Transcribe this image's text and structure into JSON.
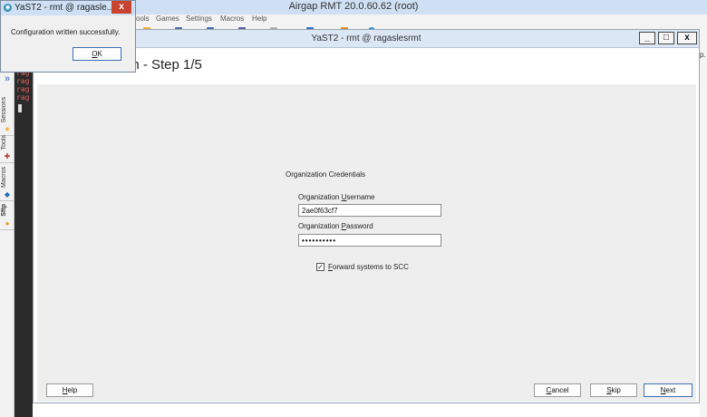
{
  "app": {
    "title": "Airgap RMT 20.0.60.62 (root)",
    "menu": [
      "ools",
      "Games",
      "Settings",
      "Macros",
      "Help"
    ]
  },
  "sidebar": {
    "tabs": [
      {
        "label": "Sessions",
        "icon": "star-icon"
      },
      {
        "label": "Tools",
        "icon": "tools-icon"
      },
      {
        "label": "Macros",
        "icon": "macro-icon"
      },
      {
        "label": "Sftp",
        "icon": "sftp-icon"
      }
    ]
  },
  "terminal": {
    "lines": [
      "rag",
      "rag",
      "rag",
      "rag"
    ]
  },
  "right_gutter": {
    "text": "p."
  },
  "yast": {
    "title": "YaST2 - rmt @ ragaslesrmt",
    "heading": "on - Step 1/5",
    "section_title": "Organization Credentials",
    "username": {
      "label_pre": "Organization ",
      "label_ul": "U",
      "label_post": "sername",
      "value": "2ae0f63cf7"
    },
    "password": {
      "label_pre": "Organization ",
      "label_ul": "P",
      "label_post": "assword",
      "value": "••••••••••"
    },
    "forward": {
      "checked": "✓",
      "label_ul": "F",
      "label_post": "orward systems to SCC"
    },
    "buttons": {
      "help": {
        "ul": "H",
        "rest": "elp"
      },
      "cancel": {
        "ul": "C",
        "rest": "ancel"
      },
      "skip": {
        "ul": "S",
        "rest": "kip"
      },
      "next": {
        "ul": "N",
        "rest": "ext"
      }
    },
    "window_buttons": {
      "minimize": "_",
      "maximize": "□",
      "close": "x"
    }
  },
  "popup": {
    "title": "YaST2 - rmt @ ragasle...",
    "close": "x",
    "message": "Configuration written successfully.",
    "ok": {
      "ul": "O",
      "rest": "K"
    }
  },
  "colors": {
    "accent": "#3b6fb3",
    "close_red": "#c8442f",
    "terminal_bg": "#2a2a2a",
    "terminal_text": "#e06060"
  }
}
